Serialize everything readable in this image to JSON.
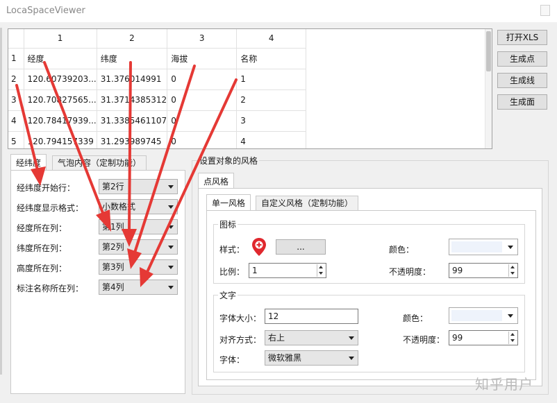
{
  "window": {
    "title": "LocaSpaceViewer"
  },
  "sheet": {
    "col_headers": [
      "1",
      "2",
      "3",
      "4"
    ],
    "rows": [
      {
        "num": "1",
        "cells": [
          "经度",
          "纬度",
          "海拔",
          "名称"
        ]
      },
      {
        "num": "2",
        "cells": [
          "120.60739203...",
          "31.376014991",
          "0",
          "1"
        ]
      },
      {
        "num": "3",
        "cells": [
          "120.70827565...",
          "31.3714385312",
          "0",
          "2"
        ]
      },
      {
        "num": "4",
        "cells": [
          "120.78417939...",
          "31.3385461107",
          "0",
          "3"
        ]
      },
      {
        "num": "5",
        "cells": [
          "120.794157339",
          "31.293989745",
          "0",
          "4"
        ]
      }
    ]
  },
  "buttons": {
    "open_xls": "打开XLS",
    "gen_point": "生成点",
    "gen_line": "生成线",
    "gen_polygon": "生成面"
  },
  "left_tabs": [
    "经纬度",
    "气泡内容（定制功能）"
  ],
  "left_fields": [
    {
      "label": "经纬度开始行：",
      "value": "第2行"
    },
    {
      "label": "经纬度显示格式：",
      "value": "小数格式"
    },
    {
      "label": "经度所在列：",
      "value": "第1列"
    },
    {
      "label": "纬度所在列：",
      "value": "第2列"
    },
    {
      "label": "高度所在列：",
      "value": "第3列"
    },
    {
      "label": "标注名称所在列：",
      "value": "第4列"
    }
  ],
  "style_group": {
    "title": "设置对象的风格",
    "tab": "点风格",
    "subtabs": [
      "单一风格",
      "自定义风格（定制功能）"
    ],
    "icon_group": {
      "title": "图标",
      "style_label": "样式：",
      "browse_label": "...",
      "color_label": "颜色：",
      "scale_label": "比例：",
      "scale_value": "1",
      "opacity_label": "不透明度：",
      "opacity_value": "99"
    },
    "text_group": {
      "title": "文字",
      "font_size_label": "字体大小：",
      "font_size_value": "12",
      "color_label": "颜色：",
      "align_label": "对齐方式：",
      "align_value": "右上",
      "opacity_label": "不透明度：",
      "opacity_value": "99",
      "font_label": "字体：",
      "font_value": "微软雅黑"
    },
    "swatch_color": "#eef3fb",
    "pin_color": "#e0282e"
  },
  "annotation_color": "#e53935",
  "watermark": "知乎用户"
}
